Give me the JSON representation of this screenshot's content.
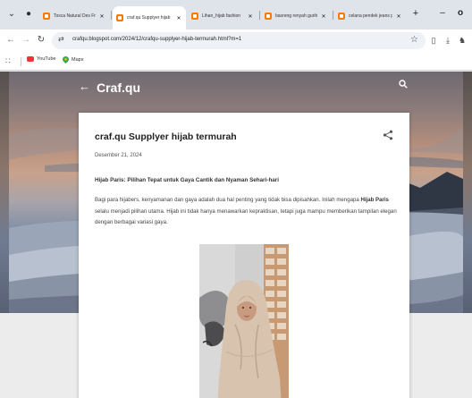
{
  "browser": {
    "tabs": [
      {
        "label": "Tosca Natural Des Fresh",
        "active": false
      },
      {
        "label": "craf.qu Supplyer hijab",
        "active": true
      },
      {
        "label": "Lihan_hijab fashion",
        "active": false
      },
      {
        "label": "basreng renyah gurih",
        "active": false
      },
      {
        "label": "celana pendek jeans pr",
        "active": false
      }
    ],
    "new_tab": "+",
    "url": "crafqu.blogspot.com/2024/12/crafqu-supplyer-hijab-termurah.html?m=1",
    "bookmarks": [
      {
        "label": "YouTube",
        "icon": "youtube-icon"
      },
      {
        "label": "Maps",
        "icon": "maps-icon"
      }
    ],
    "icons": {
      "tab_search": "chevron-down-icon",
      "back": "arrow-left-icon",
      "forward": "arrow-right-icon",
      "reload": "reload-icon",
      "bookmark": "star-icon",
      "download": "download-icon",
      "extension": "puzzle-icon",
      "apps": "apps-grid-icon"
    }
  },
  "blog": {
    "title": "Craf.qu",
    "back_icon": "arrow-left-icon",
    "search_icon": "search-icon"
  },
  "post": {
    "title": "craf.qu Supplyer hijab termurah",
    "date": "Desember 21, 2024",
    "heading": "Hijab Paris: Pilihan Tepat untuk Gaya Cantik dan Nyaman Sehari-hari",
    "body_part1": "Bagi para hijabers, kenyamanan dan gaya adalah dua hal penting yang tidak bisa dipisahkan. Inilah mengapa ",
    "body_bold": "Hijab Paris",
    "body_part2": " selalu menjadi pilihan utama. Hijab ini tidak hanya menawarkan kepraktisan, tetapi juga mampu memberikan tampilan elegan dengan berbagai variasi gaya.",
    "share_icon": "share-icon"
  },
  "colors": {
    "tabstrip": "#dfe3ea",
    "favicon": "#f57c00",
    "youtube": "#e53935",
    "card": "#ffffff"
  }
}
